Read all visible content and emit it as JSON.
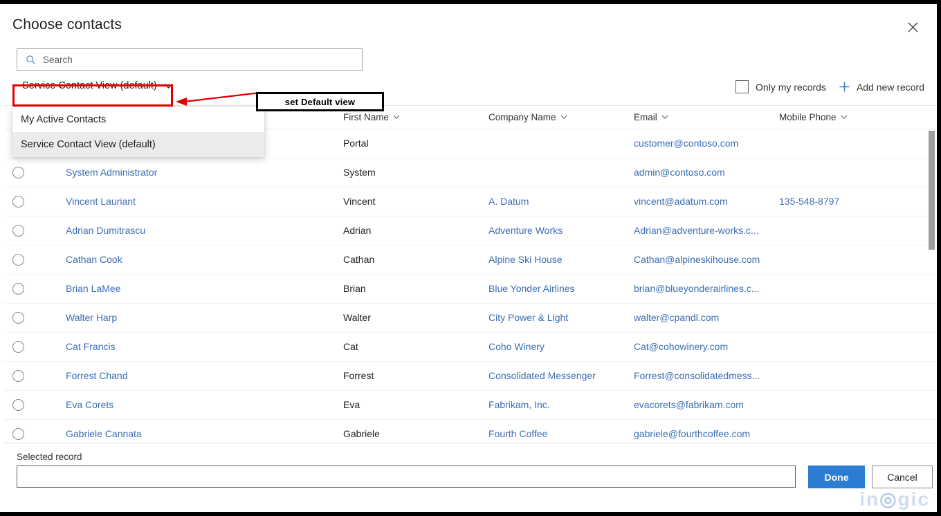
{
  "dialog": {
    "title": "Choose contacts",
    "close_icon": "close-icon"
  },
  "search": {
    "placeholder": "Search",
    "value": "",
    "icon": "search-icon"
  },
  "command_bar": {
    "view_selector": {
      "label": "Service Contact View (default)",
      "chevron_icon": "chevron-down-icon"
    },
    "only_my_records": {
      "label": "Only my records",
      "checked": false
    },
    "add_new_record": {
      "label": "Add new record",
      "icon": "plus-icon"
    }
  },
  "view_dropdown": {
    "open": true,
    "items": [
      {
        "label": "My Active Contacts",
        "selected": false
      },
      {
        "label": "Service Contact View (default)",
        "selected": true
      }
    ]
  },
  "annotation": {
    "callout_text": "set Default view",
    "highlight_color": "#e00000",
    "arrow_color": "#e00000",
    "box_color": "#000000"
  },
  "grid": {
    "columns": [
      {
        "label": "",
        "key": "select"
      },
      {
        "label": "",
        "key": "full_name"
      },
      {
        "label": "First Name",
        "key": "first_name",
        "sort_icon": "chevron-down-icon"
      },
      {
        "label": "Company Name",
        "key": "company_name",
        "sort_icon": "chevron-down-icon"
      },
      {
        "label": "Email",
        "key": "email",
        "sort_icon": "chevron-down-icon"
      },
      {
        "label": "Mobile Phone",
        "key": "mobile_phone",
        "sort_icon": "chevron-down-icon"
      }
    ],
    "rows": [
      {
        "full_name": "",
        "first_name": "Portal",
        "company_name": "",
        "email": "customer@contoso.com",
        "mobile_phone": "",
        "partial": true
      },
      {
        "full_name": "System Administrator",
        "first_name": "System",
        "company_name": "",
        "email": "admin@contoso.com",
        "mobile_phone": ""
      },
      {
        "full_name": "Vincent Lauriant",
        "first_name": "Vincent",
        "company_name": "A. Datum",
        "email": "vincent@adatum.com",
        "mobile_phone": "135-548-8797"
      },
      {
        "full_name": "Adrian Dumitrascu",
        "first_name": "Adrian",
        "company_name": "Adventure Works",
        "email": "Adrian@adventure-works.c...",
        "mobile_phone": ""
      },
      {
        "full_name": "Cathan Cook",
        "first_name": "Cathan",
        "company_name": "Alpine Ski House",
        "email": "Cathan@alpineskihouse.com",
        "mobile_phone": ""
      },
      {
        "full_name": "Brian LaMee",
        "first_name": "Brian",
        "company_name": "Blue Yonder Airlines",
        "email": "brian@blueyonderairlines.c...",
        "mobile_phone": ""
      },
      {
        "full_name": "Walter Harp",
        "first_name": "Walter",
        "company_name": "City Power & Light",
        "email": "walter@cpandl.com",
        "mobile_phone": ""
      },
      {
        "full_name": "Cat Francis",
        "first_name": "Cat",
        "company_name": "Coho Winery",
        "email": "Cat@cohowinery.com",
        "mobile_phone": ""
      },
      {
        "full_name": "Forrest Chand",
        "first_name": "Forrest",
        "company_name": "Consolidated Messenger",
        "email": "Forrest@consolidatedmess...",
        "mobile_phone": ""
      },
      {
        "full_name": "Eva Corets",
        "first_name": "Eva",
        "company_name": "Fabrikam, Inc.",
        "email": "evacorets@fabrikam.com",
        "mobile_phone": ""
      },
      {
        "full_name": "Gabriele Cannata",
        "first_name": "Gabriele",
        "company_name": "Fourth Coffee",
        "email": "gabriele@fourthcoffee.com",
        "mobile_phone": "",
        "cut_off": true
      }
    ],
    "scrollbar": {
      "visible": true
    }
  },
  "footer": {
    "selected_record_label": "Selected record",
    "selected_record_value": "",
    "done_label": "Done",
    "cancel_label": "Cancel"
  },
  "watermark": {
    "text_before": "in",
    "text_dot": "◎",
    "text_after": "gic"
  },
  "colors": {
    "accent": "#2b7cd3",
    "link": "#3b6eb5",
    "annotation_red": "#e00000",
    "row_divider": "#f3f2f1"
  }
}
